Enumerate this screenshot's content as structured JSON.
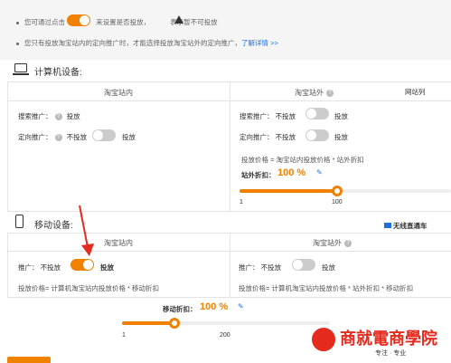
{
  "notice": {
    "line1_prefix": "您可通过点击",
    "line1_mid": "来设置是否投放，",
    "line1_suffix": "表示暂不可投放",
    "line2_text": "您只有投放淘宝站内的定向推广时，才能选择投放淘宝站外的定向推广，",
    "line2_link": "了解详情 >>"
  },
  "computer": {
    "title": "计算机设备:",
    "tab_inside": "淘宝站内",
    "tab_outside": "淘宝站外",
    "side_link": "网站列",
    "inside": {
      "search_label": "搜索推广：",
      "search_value": "投放",
      "targeting_label": "定向推广：",
      "off_label": "不投放",
      "on_label": "投放"
    },
    "outside": {
      "search_label": "搜索推广：",
      "targeting_label": "定向推广：",
      "off_label": "不投放",
      "on_label": "投放",
      "price_formula": "投放价格 = 淘宝站内投放价格 * 站外折扣",
      "discount_label": "站外折扣：",
      "discount_value": "100 %",
      "slider_min": "1",
      "slider_max": "100",
      "slider_level": 1.0
    }
  },
  "mobile": {
    "title": "移动设备:",
    "tab_inside": "淘宝站内",
    "tab_outside": "淘宝站外",
    "side_link": "无线直通车",
    "inside": {
      "promo_label": "推广：",
      "off_label": "不投放",
      "on_label": "投放",
      "price_formula": "投放价格= 计算机淘宝站内投放价格 * 移动折扣"
    },
    "outside": {
      "promo_label": "推广：",
      "off_label": "不投放",
      "on_label": "投放",
      "price_formula": "投放价格= 计算机淘宝站内投放价格 * 站外折扣 * 移动折扣"
    },
    "discount_label": "移动折扣：",
    "discount_value": "100 %",
    "slider_min": "1",
    "slider_max": "200",
    "slider_level": 0.5
  },
  "watermark": {
    "brand": "商就電商學院",
    "tagline": "专注 · 专业"
  },
  "colors": {
    "accent": "#f08200",
    "link": "#1e6fd9",
    "arrow": "#e52a1e"
  }
}
